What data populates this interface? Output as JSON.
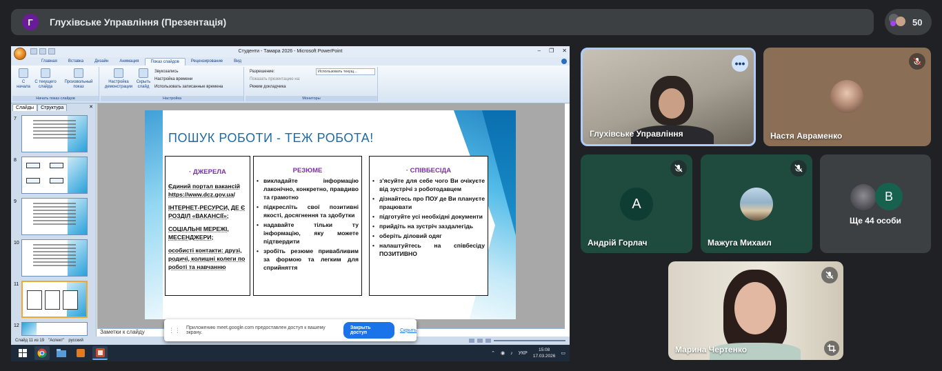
{
  "meeting": {
    "avatar_letter": "Г",
    "title": "Глухівське Управління (Презентація)",
    "participants_count": "50"
  },
  "ppt": {
    "window_title": "Студенти - Тамара 2026 - Microsoft PowerPoint",
    "tabs": [
      "Главная",
      "Вставка",
      "Дизайн",
      "Анимация",
      "Показ слайдов",
      "Рецензирование",
      "Вид"
    ],
    "active_tab": "Показ слайдов",
    "ribbon": {
      "btn_from_start": "С начала",
      "btn_from_current": "С текущего слайда",
      "btn_custom": "Произвольный показ",
      "group_start": "Начать показ слайдов",
      "btn_setup": "Настройка демонстрации",
      "btn_hide": "Скрыть слайд",
      "chk_narration": "Звукозапись",
      "chk_timings": "Настройка времени",
      "chk_use_timings": "Использовать записанные времена",
      "group_setup": "Настройка",
      "resolution_label": "Разрешение:",
      "resolution_value": "Использовать текущ...",
      "show_on_label": "Показать презентацию на:",
      "presenter_view": "Режим докладчика",
      "group_monitors": "Мониторы"
    },
    "panel_tabs": [
      "Слайды",
      "Структура"
    ],
    "thumb_numbers": [
      "7",
      "8",
      "9",
      "10",
      "11",
      "12"
    ],
    "notes_placeholder": "Заметки к слайду",
    "status": {
      "slide_info": "Слайд 11 из 19",
      "theme": "\"Аспект\"",
      "language": "русский"
    },
    "tray": {
      "lang": "УКР",
      "time": "15:08",
      "date": "17.03.2026"
    }
  },
  "slide": {
    "title": "ПОШУК РОБОТИ - ТЕЖ РОБОТА!",
    "col1": {
      "head": "ДЖЕРЕЛА",
      "items": [
        "Єдиний портал вакансій https://www.dcz.gov.ua/",
        "ІНТЕРНЕТ-РЕСУРСИ, ДЕ Є РОЗДІЛ «ВАКАНСІЇ»;",
        "СОЦІАЛЬНІ МЕРЕЖІ, МЕСЕНДЖЕРИ;",
        "особисті контакти: друзі, родичі, колишні колеги по роботі та навчанню"
      ]
    },
    "col2": {
      "head": "РЕЗЮМЕ",
      "items": [
        "викладайте інформацію лаконічно, конкретно, правдиво та грамотно",
        "підкресліть свої позитивні якості, досягнення та здобутки",
        "надавайте тільки ту інформацію, яку можете підтвердити",
        "зробіть резюме привабливим за формою та легким для сприйняття"
      ]
    },
    "col3": {
      "head": "СПІВБЕСІДА",
      "items": [
        "з’ясуйте для себе чого Ви очікуєте від зустрічі з роботодавцем",
        "дізнайтесь про ПОУ де Ви плануєте працювати",
        "підготуйте усі необхідні документи",
        "прийдіть на зустріч заздалегідь",
        "оберіть діловий одяг",
        "налаштуйтесь на співбесіду ПОЗИТИВНО"
      ]
    }
  },
  "share_banner": {
    "message": "Приложению meet.google.com предоставлен доступ к вашему экрану.",
    "stop_button": "Закрыть доступ",
    "hide_link": "Скрыть"
  },
  "participants": {
    "p1": "Глухівське Управління",
    "p2": "Настя Авраменко",
    "p3": "Андрій Горлач",
    "p3_letter": "А",
    "p4": "Мажуга Михаил",
    "more": "Ще 44 особи",
    "more_letter": "В",
    "p5": "Марина Чертенко"
  },
  "colors": {
    "background": "#202124",
    "tile": "#3c4043",
    "accent_blue": "#1a73e8",
    "slide_title": "#1d6aa5",
    "slide_head": "#7b2fa8"
  }
}
